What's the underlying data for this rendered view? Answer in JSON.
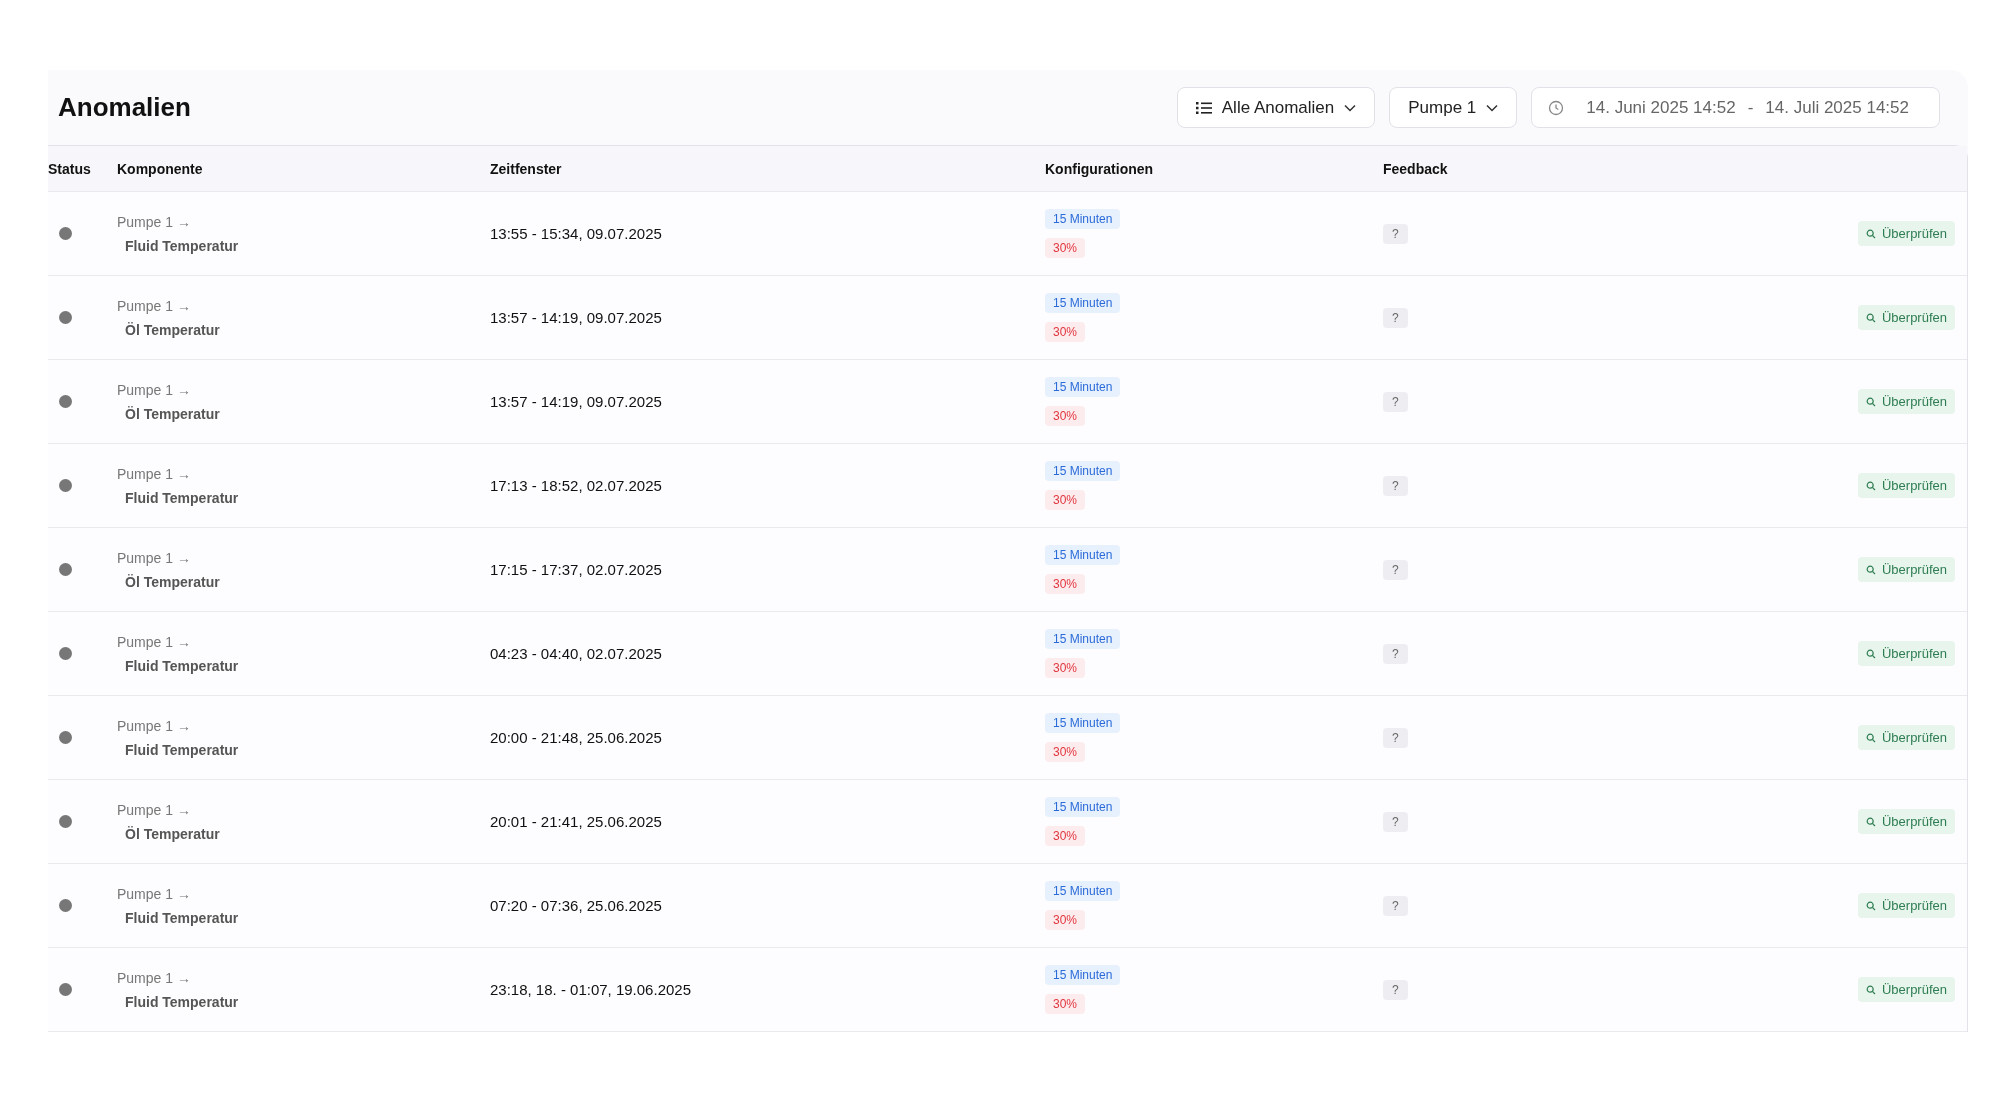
{
  "title": "Anomalien",
  "filters": {
    "type_filter": "Alle Anomalien",
    "component_filter": "Pumpe 1",
    "date_from": "14. Juni 2025 14:52",
    "date_separator": "-",
    "date_to": "14. Juli 2025 14:52"
  },
  "table": {
    "columns": [
      "Status",
      "Komponente",
      "Zeitfenster",
      "Konfigurationen",
      "Feedback"
    ],
    "rows": [
      {
        "parent": "Pumpe 1 →",
        "component": "Fluid Temperatur",
        "time_window": "13:55 - 15:34, 09.07.2025",
        "window": "15 Minuten",
        "threshold": "30%",
        "feedback": "?",
        "action": "Überprüfen"
      },
      {
        "parent": "Pumpe 1 →",
        "component": "Öl Temperatur",
        "time_window": "13:57 - 14:19, 09.07.2025",
        "window": "15 Minuten",
        "threshold": "30%",
        "feedback": "?",
        "action": "Überprüfen"
      },
      {
        "parent": "Pumpe 1 →",
        "component": "Öl Temperatur",
        "time_window": "13:57 - 14:19, 09.07.2025",
        "window": "15 Minuten",
        "threshold": "30%",
        "feedback": "?",
        "action": "Überprüfen"
      },
      {
        "parent": "Pumpe 1 →",
        "component": "Fluid Temperatur",
        "time_window": "17:13 - 18:52, 02.07.2025",
        "window": "15 Minuten",
        "threshold": "30%",
        "feedback": "?",
        "action": "Überprüfen"
      },
      {
        "parent": "Pumpe 1 →",
        "component": "Öl Temperatur",
        "time_window": "17:15 - 17:37, 02.07.2025",
        "window": "15 Minuten",
        "threshold": "30%",
        "feedback": "?",
        "action": "Überprüfen"
      },
      {
        "parent": "Pumpe 1 →",
        "component": "Fluid Temperatur",
        "time_window": "04:23 - 04:40, 02.07.2025",
        "window": "15 Minuten",
        "threshold": "30%",
        "feedback": "?",
        "action": "Überprüfen"
      },
      {
        "parent": "Pumpe 1 →",
        "component": "Fluid Temperatur",
        "time_window": "20:00 - 21:48, 25.06.2025",
        "window": "15 Minuten",
        "threshold": "30%",
        "feedback": "?",
        "action": "Überprüfen"
      },
      {
        "parent": "Pumpe 1 →",
        "component": "Öl Temperatur",
        "time_window": "20:01 - 21:41, 25.06.2025",
        "window": "15 Minuten",
        "threshold": "30%",
        "feedback": "?",
        "action": "Überprüfen"
      },
      {
        "parent": "Pumpe 1 →",
        "component": "Fluid Temperatur",
        "time_window": "07:20 - 07:36, 25.06.2025",
        "window": "15 Minuten",
        "threshold": "30%",
        "feedback": "?",
        "action": "Überprüfen"
      },
      {
        "parent": "Pumpe 1 →",
        "component": "Fluid Temperatur",
        "time_window": "23:18, 18. - 01:07, 19.06.2025",
        "window": "15 Minuten",
        "threshold": "30%",
        "feedback": "?",
        "action": "Überprüfen"
      }
    ]
  }
}
